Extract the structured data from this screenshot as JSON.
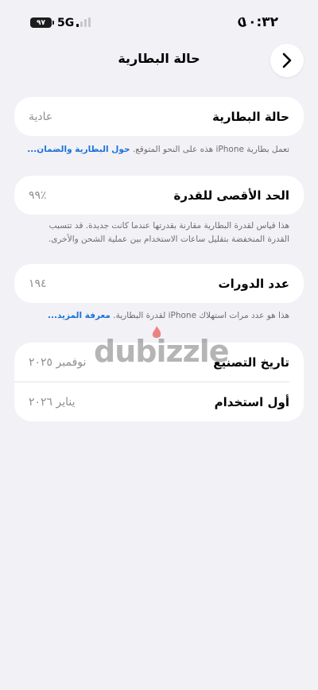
{
  "status_bar": {
    "time": "١٠:٣٢",
    "battery_level": "٩٧",
    "network": "5G"
  },
  "nav": {
    "title": "حالة البطارية"
  },
  "battery_health": {
    "label": "حالة البطارية",
    "value": "عادية",
    "note_text": "تعمل بطارية iPhone هذه على النحو المتوقع. ",
    "note_link": "حول البطارية والضمان..."
  },
  "max_capacity": {
    "label": "الحد الأقصى للقدرة",
    "value": "٪٩٩",
    "note_text": "هذا قياس لقدرة البطارية مقارنة بقدرتها عندما كانت جديدة. قد تتسبب القدرة المنخفضة بتقليل ساعات الاستخدام بين عملية الشحن والأخرى."
  },
  "cycle_count": {
    "label": "عدد الدورات",
    "value": "١٩٤",
    "note_text": "هذا هو عدد مرات استهلاك iPhone لقدرة البطارية. ",
    "note_link": "معرفة المزيد..."
  },
  "dates": {
    "manufacture_label": "تاريخ التصنيع",
    "manufacture_value": "نوفمبر ٢٠٢٥",
    "first_use_label": "أول استخدام",
    "first_use_value": "يناير ٢٠٢٦"
  },
  "watermark": {
    "text": "dubizzle"
  },
  "colors": {
    "background": "#f2f1f6",
    "card": "#ffffff",
    "link": "#1a73d9",
    "secondary_text": "#8e8e93",
    "watermark_flame": "#e53935"
  }
}
